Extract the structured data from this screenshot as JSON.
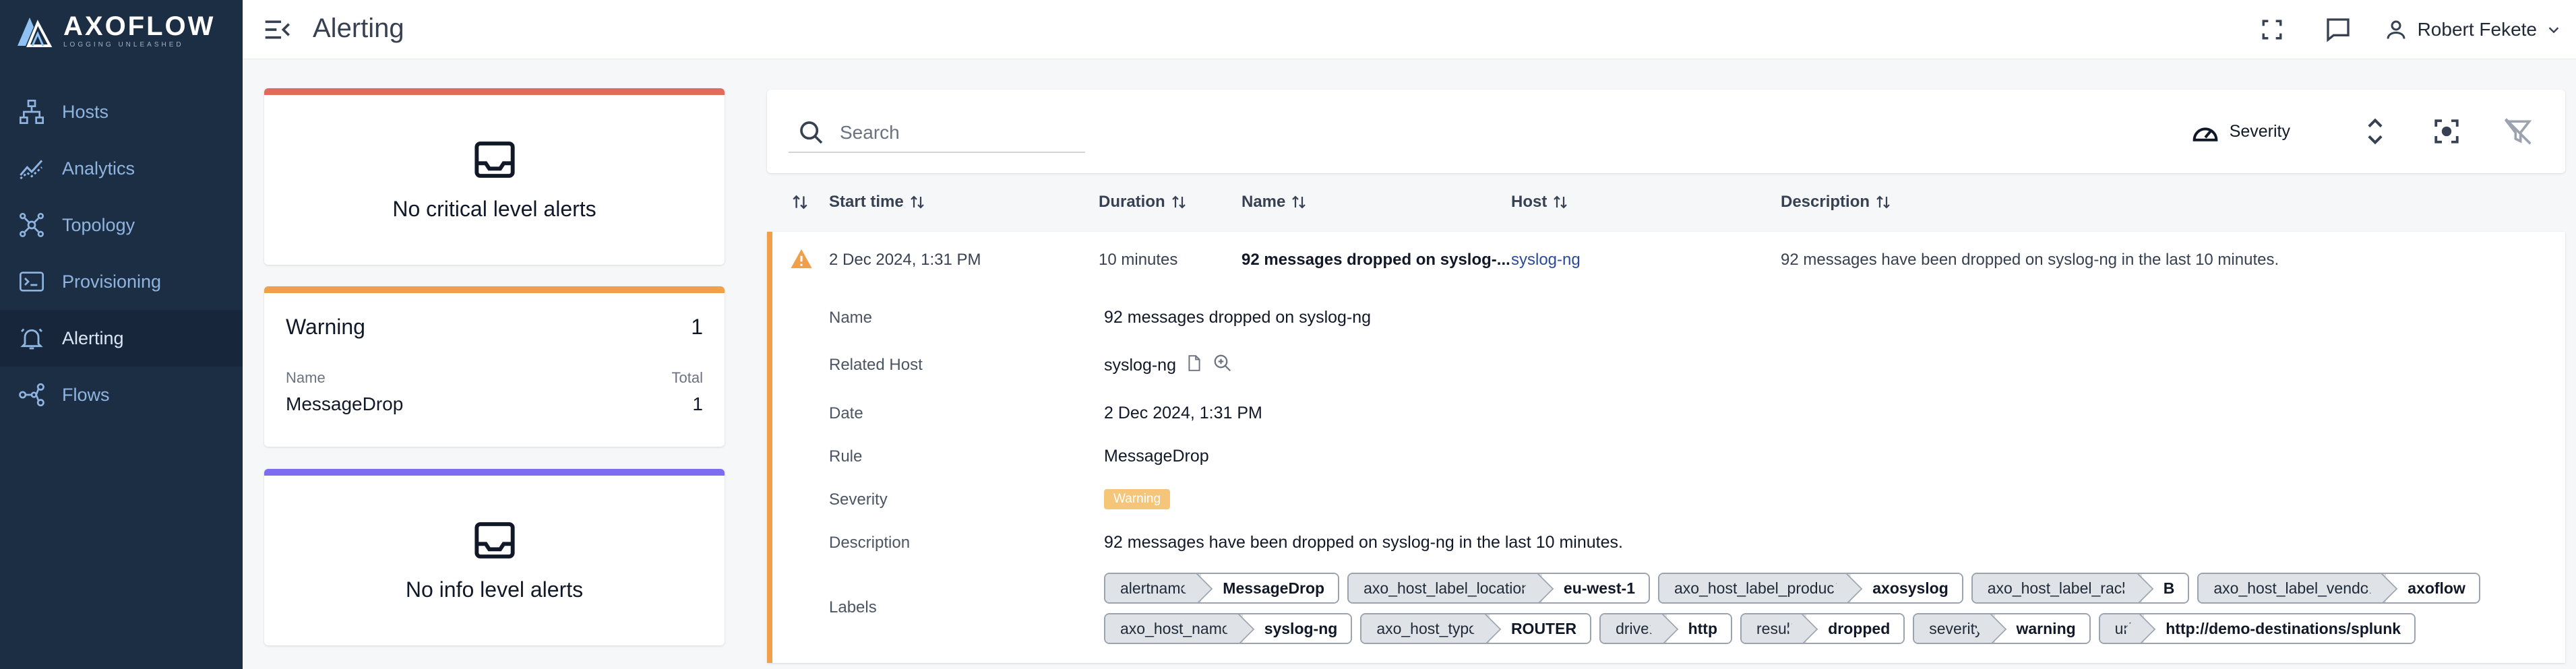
{
  "app": {
    "brand": "AXOFLOW",
    "tagline": "LOGGING UNLEASHED"
  },
  "sidebar": {
    "items": [
      {
        "label": "Hosts",
        "icon": "hosts-icon"
      },
      {
        "label": "Analytics",
        "icon": "analytics-icon"
      },
      {
        "label": "Topology",
        "icon": "topology-icon"
      },
      {
        "label": "Provisioning",
        "icon": "provisioning-icon"
      },
      {
        "label": "Alerting",
        "icon": "alerting-icon",
        "active": true
      },
      {
        "label": "Flows",
        "icon": "flows-icon"
      }
    ]
  },
  "header": {
    "title": "Alerting",
    "user": "Robert Fekete"
  },
  "summary": {
    "critical": {
      "message": "No critical level alerts",
      "color": "#e06a5c"
    },
    "warning": {
      "title": "Warning",
      "count": "1",
      "col_name": "Name",
      "col_total": "Total",
      "row_name": "MessageDrop",
      "row_total": "1",
      "color": "#f0a04b"
    },
    "info": {
      "message": "No info level alerts",
      "color": "#7b6cf0"
    }
  },
  "toolbar": {
    "search_placeholder": "Search",
    "severity_label": "Severity"
  },
  "table": {
    "columns": [
      "Start time",
      "Duration",
      "Name",
      "Host",
      "Description"
    ],
    "row": {
      "start_time": "2 Dec 2024, 1:31 PM",
      "duration": "10 minutes",
      "name": "92 messages dropped on syslog-...",
      "host": "syslog-ng",
      "description": "92 messages have been dropped on syslog-ng in the last 10 minutes."
    }
  },
  "details": {
    "name_label": "Name",
    "name_value": "92 messages dropped on syslog-ng",
    "host_label": "Related Host",
    "host_value": "syslog-ng",
    "date_label": "Date",
    "date_value": "2 Dec 2024, 1:31 PM",
    "rule_label": "Rule",
    "rule_value": "MessageDrop",
    "severity_label": "Severity",
    "severity_value": "Warning",
    "description_label": "Description",
    "description_value": "92 messages have been dropped on syslog-ng in the last 10 minutes.",
    "labels_label": "Labels"
  },
  "labels": {
    "row1": [
      {
        "k": "alertname",
        "v": "MessageDrop"
      },
      {
        "k": "axo_host_label_location",
        "v": "eu-west-1"
      },
      {
        "k": "axo_host_label_product",
        "v": "axosyslog"
      },
      {
        "k": "axo_host_label_rack",
        "v": "B"
      },
      {
        "k": "axo_host_label_vendor",
        "v": "axoflow"
      }
    ],
    "row2": [
      {
        "k": "axo_host_name",
        "v": "syslog-ng"
      },
      {
        "k": "axo_host_type",
        "v": "ROUTER"
      },
      {
        "k": "driver",
        "v": "http"
      },
      {
        "k": "result",
        "v": "dropped"
      },
      {
        "k": "severity",
        "v": "warning"
      },
      {
        "k": "url",
        "v": "http://demo-destinations/splunk"
      }
    ]
  }
}
